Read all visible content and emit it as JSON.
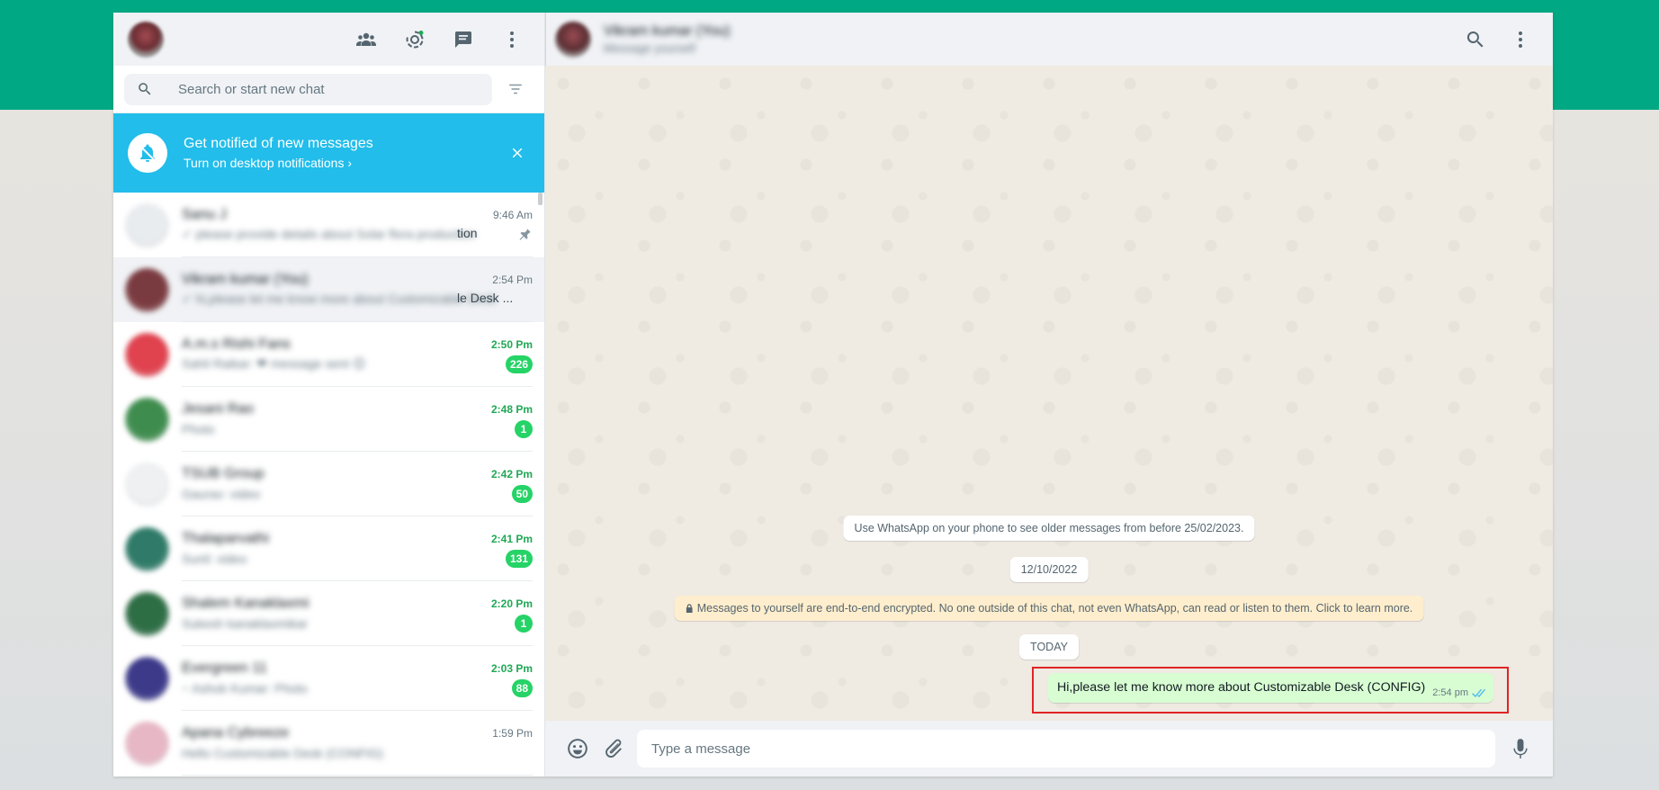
{
  "sidebar": {
    "header": {
      "icons": [
        "communities-icon",
        "status-icon",
        "new-chat-icon",
        "menu-icon"
      ]
    },
    "search": {
      "placeholder": "Search or start new chat"
    },
    "notification": {
      "title": "Get notified of new messages",
      "subtitle": "Turn on desktop notifications ›"
    },
    "chats": [
      {
        "name": "Sanu J",
        "preview": "✓ please provide details about Solar flora production",
        "tail": "tion",
        "time": "9:46 Am",
        "unread": false,
        "badge": "",
        "pinned": true,
        "color": "#e9ecef"
      },
      {
        "name": "Vikram kumar (You)",
        "preview": "✓ hi,please let me know more about Customizable Desk",
        "tail": "le Desk ...",
        "time": "2:54 Pm",
        "unread": false,
        "badge": "",
        "pinned": false,
        "color": "#7a3b40",
        "active": true
      },
      {
        "name": "A.m.s Rishi Fans",
        "preview": "Sahil Raikar: ❤ message sent 😊",
        "tail": "",
        "time": "2:50 Pm",
        "unread": true,
        "badge": "226",
        "pinned": false,
        "color": "#e0424e"
      },
      {
        "name": "Jesani Rao",
        "preview": "Photo",
        "tail": "",
        "time": "2:48 Pm",
        "unread": true,
        "badge": "1",
        "pinned": false,
        "color": "#3f8d4e"
      },
      {
        "name": "TSUB Group",
        "preview": "Gaurav: video",
        "tail": "",
        "time": "2:42 Pm",
        "unread": true,
        "badge": "50",
        "pinned": false,
        "color": "#eef0f2"
      },
      {
        "name": "Thalaparvathi",
        "preview": "Sunil: video",
        "tail": "",
        "time": "2:41 Pm",
        "unread": true,
        "badge": "131",
        "pinned": false,
        "color": "#2f7a68"
      },
      {
        "name": "Shalem Kanaklaxmi",
        "preview": "Sukesh kanaklaxmikar",
        "tail": "",
        "time": "2:20 Pm",
        "unread": true,
        "badge": "1",
        "pinned": false,
        "color": "#2e6e45"
      },
      {
        "name": "Evergreen 11",
        "preview": "~ Ashok Kumar: Photo",
        "tail": "",
        "time": "2:03 Pm",
        "unread": true,
        "badge": "88",
        "pinned": false,
        "color": "#3d3a8a"
      },
      {
        "name": "Apana Cybreeze",
        "preview": "Hello Customizable Desk (CONFIG)",
        "tail": "",
        "time": "1:59 Pm",
        "unread": false,
        "badge": "",
        "pinned": false,
        "color": "#e7b7c5"
      }
    ]
  },
  "conversation": {
    "name": "Vikram kumar (You)",
    "status": "Message yourself",
    "system": {
      "older": "Use WhatsApp on your phone to see older messages from before 25/02/2023.",
      "date": "12/10/2022",
      "encryption": "Messages to yourself are end-to-end encrypted. No one outside of this chat, not even WhatsApp, can read or listen to them. Click to learn more.",
      "today": "TODAY"
    },
    "message": {
      "text": "Hi,please let me know more about Customizable Desk (CONFIG)",
      "time": "2:54 pm"
    },
    "composer": {
      "placeholder": "Type a message"
    }
  }
}
